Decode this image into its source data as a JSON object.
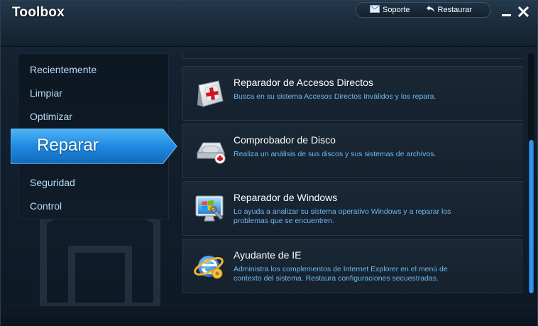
{
  "window": {
    "title": "Toolbox"
  },
  "topbar": {
    "support_label": "Soporte",
    "restore_label": "Restaurar"
  },
  "sidebar": {
    "items": [
      {
        "label": "Recientemente"
      },
      {
        "label": "Limpiar"
      },
      {
        "label": "Optimizar"
      },
      {
        "label": "Reparar",
        "active": true
      },
      {
        "label": "Seguridad"
      },
      {
        "label": "Control"
      }
    ]
  },
  "tools": [
    {
      "title": "Reparador de Accesos Directos",
      "description": "Busca en su sistema Accesos Directos Inválidos y los repara.",
      "icon": "shortcut-repair-icon"
    },
    {
      "title": "Comprobador de Disco",
      "description": "Realiza un análisis de sus discos y sus sistemas de archivos.",
      "icon": "disk-check-icon"
    },
    {
      "title": "Reparador de Windows",
      "description": "Lo ayuda a analizar su sistema operativo Windows y a reparar los problemas que se encuentren.",
      "icon": "windows-repair-icon"
    },
    {
      "title": "Ayudante de IE",
      "description": "Administra los complementos de Internet Explorer en el menú de contexto del sistema. Restaura configuraciones secuestradas.",
      "icon": "ie-helper-icon"
    }
  ],
  "colors": {
    "accent": "#1e8fe8",
    "description_text": "#6fb9f2",
    "nav_text": "#b9dbf5",
    "background": "#0f1a26"
  }
}
